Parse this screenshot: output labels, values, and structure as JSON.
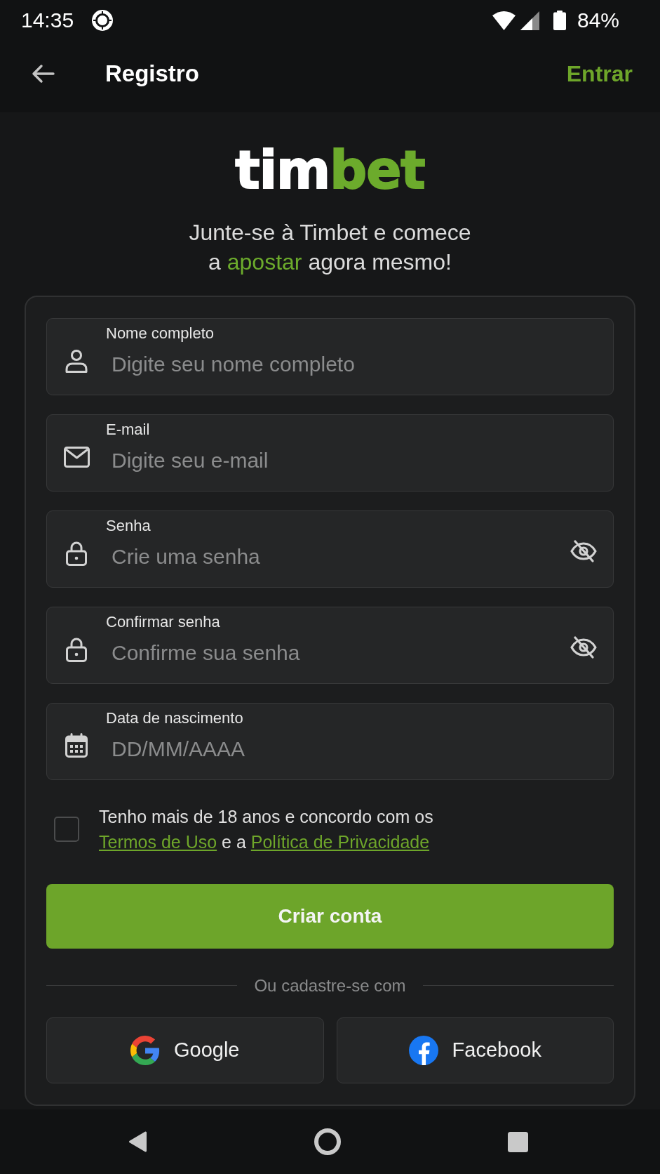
{
  "status_bar": {
    "time": "14:35",
    "battery": "84%"
  },
  "header": {
    "title": "Registro",
    "action": "Entrar"
  },
  "logo": {
    "text": "tim",
    "accent": "bet"
  },
  "tagline": {
    "before": "Junte-se à Timbet e comece a",
    "highlight": "apostar",
    "after": "agora mesmo!"
  },
  "fields": [
    {
      "kind": "text",
      "label": "Nome completo",
      "placeholder": "Digite seu nome completo"
    },
    {
      "kind": "email",
      "label": "E-mail",
      "placeholder": "Digite seu e-mail"
    },
    {
      "kind": "password",
      "label": "Senha",
      "placeholder": "Crie uma senha"
    },
    {
      "kind": "password",
      "label": "Confirmar senha",
      "placeholder": "Confirme sua senha"
    },
    {
      "kind": "date",
      "label": "Data de nascimento",
      "placeholder": "DD/MM/AAAA"
    }
  ],
  "consent": {
    "checked": false,
    "text": "Tenho mais de 18 anos e concordo com os",
    "terms_link": "Termos de Uso",
    "joiner": "e a",
    "privacy_link": "Política de Privacidade"
  },
  "submit_button": "Criar conta",
  "divider": "Ou cadastre-se com",
  "social_buttons": [
    {
      "kind": "google",
      "label": "Google"
    },
    {
      "kind": "facebook",
      "label": "Facebook"
    }
  ]
}
